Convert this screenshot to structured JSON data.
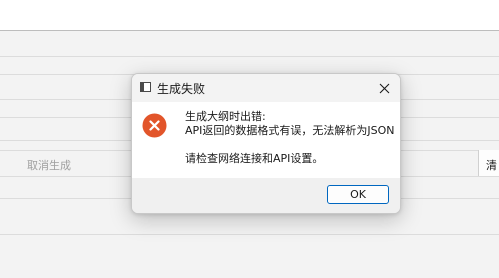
{
  "background": {
    "cancel_generate_label": "取消生成",
    "right_label": "清"
  },
  "dialog": {
    "title": "生成失败",
    "app_icon": "window-icon",
    "close_icon": "close-icon",
    "error_icon": "error-circle-x-icon",
    "error_color": "#e2552a",
    "message_line_1": "生成大纲时出错:",
    "message_line_2": "API返回的数据格式有误，无法解析为JSON",
    "message_line_3": "请检查网络连接和API设置。",
    "ok_label": "OK",
    "ok_border_color": "#0067c0"
  }
}
